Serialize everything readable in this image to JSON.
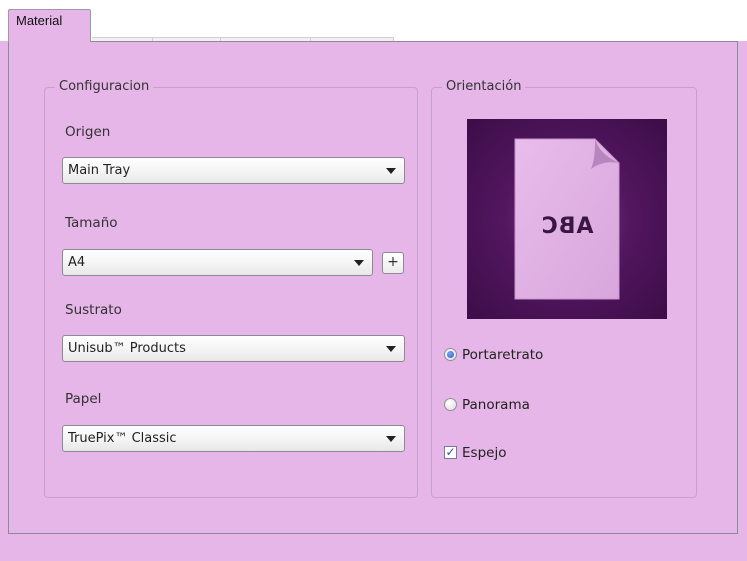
{
  "tabs": [
    {
      "label": "Material",
      "active": true
    }
  ],
  "configuracion": {
    "title": "Configuracion",
    "origen": {
      "label": "Origen",
      "value": "Main Tray"
    },
    "tamano": {
      "label": "Tamaño",
      "value": "A4",
      "add_button": "+"
    },
    "sustrato": {
      "label": "Sustrato",
      "value": "Unisub™ Products"
    },
    "papel": {
      "label": "Papel",
      "value": "TruePix™ Classic"
    }
  },
  "orientacion": {
    "title": "Orientación",
    "preview_text": "ABC",
    "options": {
      "portrait": {
        "label": "Portaretrato",
        "selected": true
      },
      "landscape": {
        "label": "Panorama",
        "selected": false
      }
    },
    "mirror": {
      "label": "Espejo",
      "checked": true
    }
  },
  "colors": {
    "background": "#e5b6e7",
    "preview_bg": "#52165f",
    "page_fill": "#e3b4e6"
  }
}
